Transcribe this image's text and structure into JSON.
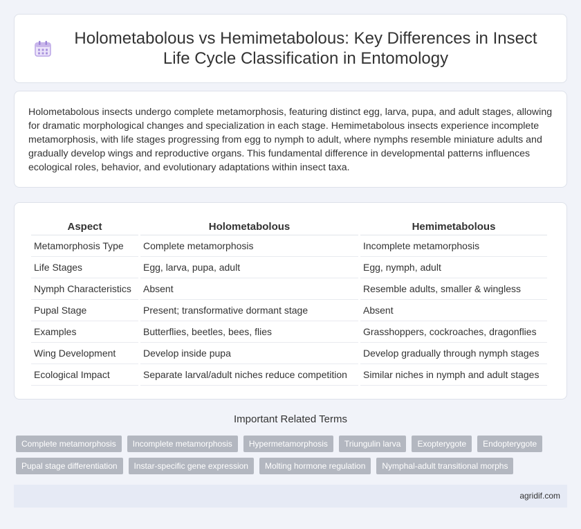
{
  "header": {
    "title": "Holometabolous vs Hemimetabolous: Key Differences in Insect Life Cycle Classification in Entomology",
    "icon": "calendar-icon"
  },
  "intro": {
    "text": "Holometabolous insects undergo complete metamorphosis, featuring distinct egg, larva, pupa, and adult stages, allowing for dramatic morphological changes and specialization in each stage. Hemimetabolous insects experience incomplete metamorphosis, with life stages progressing from egg to nymph to adult, where nymphs resemble miniature adults and gradually develop wings and reproductive organs. This fundamental difference in developmental patterns influences ecological roles, behavior, and evolutionary adaptations within insect taxa."
  },
  "table": {
    "headers": [
      "Aspect",
      "Holometabolous",
      "Hemimetabolous"
    ],
    "rows": [
      [
        "Metamorphosis Type",
        "Complete metamorphosis",
        "Incomplete metamorphosis"
      ],
      [
        "Life Stages",
        "Egg, larva, pupa, adult",
        "Egg, nymph, adult"
      ],
      [
        "Nymph Characteristics",
        "Absent",
        "Resemble adults, smaller & wingless"
      ],
      [
        "Pupal Stage",
        "Present; transformative dormant stage",
        "Absent"
      ],
      [
        "Examples",
        "Butterflies, beetles, bees, flies",
        "Grasshoppers, cockroaches, dragonflies"
      ],
      [
        "Wing Development",
        "Develop inside pupa",
        "Develop gradually through nymph stages"
      ],
      [
        "Ecological Impact",
        "Separate larval/adult niches reduce competition",
        "Similar niches in nymph and adult stages"
      ]
    ]
  },
  "related": {
    "title": "Important Related Terms",
    "terms": [
      "Complete metamorphosis",
      "Incomplete metamorphosis",
      "Hypermetamorphosis",
      "Triungulin larva",
      "Exopterygote",
      "Endopterygote",
      "Pupal stage differentiation",
      "Instar-specific gene expression",
      "Molting hormone regulation",
      "Nymphal-adult transitional morphs"
    ]
  },
  "footer": {
    "site": "agridif.com"
  },
  "colors": {
    "background": "#f1f3f9",
    "tag": "#b3b7c0",
    "footer": "#e6eaf5",
    "icon_accent": "#c9b6ea"
  }
}
